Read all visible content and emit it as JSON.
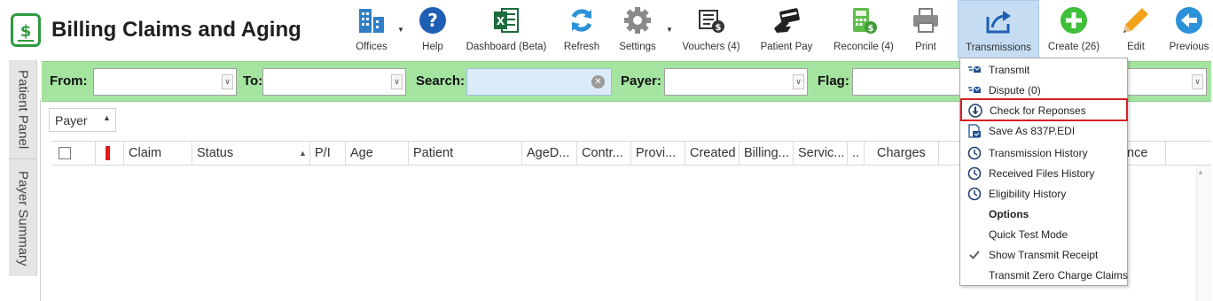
{
  "app": {
    "title": "Billing Claims and Aging"
  },
  "toolbar": {
    "items": [
      {
        "label": "Offices",
        "icon": "offices-icon"
      },
      {
        "label": "Help",
        "icon": "help-icon"
      },
      {
        "label": "Dashboard (Beta)",
        "icon": "excel-icon"
      },
      {
        "label": "Refresh",
        "icon": "refresh-icon"
      },
      {
        "label": "Settings",
        "icon": "gear-icon"
      },
      {
        "label": "Vouchers (4)",
        "icon": "voucher-icon"
      },
      {
        "label": "Patient Pay",
        "icon": "card-payment-icon"
      },
      {
        "label": "Reconcile (4)",
        "icon": "calculator-icon"
      },
      {
        "label": "Print",
        "icon": "printer-icon"
      },
      {
        "label": "Transmissions",
        "icon": "share-icon"
      },
      {
        "label": "Create (26)",
        "icon": "plus-icon"
      },
      {
        "label": "Edit",
        "icon": "pencil-icon"
      },
      {
        "label": "Previous",
        "icon": "back-arrow-icon"
      }
    ]
  },
  "side_tabs": [
    "Patient Panel",
    "Payer Summary"
  ],
  "filters": {
    "from_label": "From:",
    "to_label": "To:",
    "search_label": "Search:",
    "payer_label": "Payer:",
    "flag_label": "Flag:"
  },
  "grouping": {
    "label": "Payer"
  },
  "grid": {
    "columns": [
      "Claim",
      "Status",
      "P/I",
      "Age",
      "Patient",
      "AgeD...",
      "Contr...",
      "Provi...",
      "Created",
      "Billing...",
      "Servic...",
      "..",
      "Charges",
      "nce"
    ]
  },
  "menu": {
    "items": [
      {
        "label": "Transmit",
        "icon": "transmit-icon"
      },
      {
        "label": "Dispute (0)",
        "icon": "dispute-icon"
      },
      {
        "label": "Check for Reponses",
        "icon": "download-circle-icon"
      },
      {
        "label": "Save As 837P.EDI",
        "icon": "save-file-icon"
      },
      {
        "label": "Transmission History",
        "icon": "clock-icon"
      },
      {
        "label": "Received Files History",
        "icon": "clock-icon"
      },
      {
        "label": "Eligibility History",
        "icon": "clock-icon"
      },
      {
        "label": "Options"
      },
      {
        "label": "Quick Test Mode"
      },
      {
        "label": "Show Transmit Receipt",
        "icon": "checkmark-icon"
      },
      {
        "label": "Transmit Zero Charge Claims"
      }
    ]
  },
  "colors": {
    "filter_bar": "#a5e3a0",
    "active_tool": "#c5dcf3",
    "highlight_border": "#d81f26",
    "flag_red": "#e11b1b"
  }
}
